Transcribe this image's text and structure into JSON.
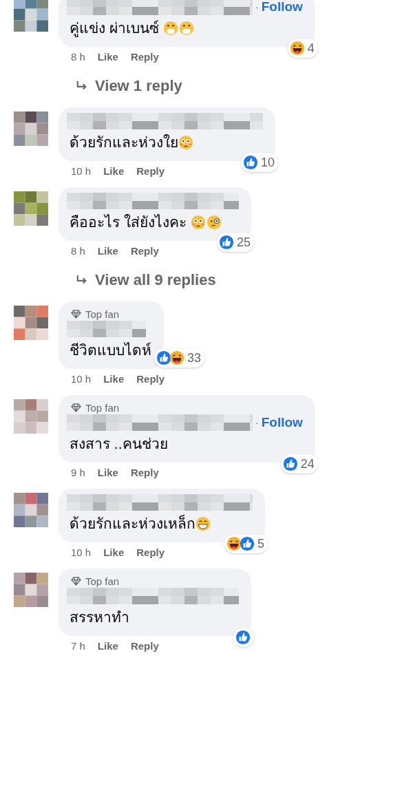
{
  "comments": [
    {
      "follow_separator": "·",
      "follow": "Follow",
      "text": "คู่แข่ง ผ่าเบนซ์ ",
      "reaction_count": "4",
      "time": "8 h",
      "like": "Like",
      "reply": "Reply",
      "view_replies": "View 1 reply"
    },
    {
      "text": "ด้วยรักและห่วงใย",
      "reaction_count": "10",
      "time": "10 h",
      "like": "Like",
      "reply": "Reply"
    },
    {
      "text": "คืออะไร ใส่ยังไงคะ ",
      "reaction_count": "25",
      "time": "8 h",
      "like": "Like",
      "reply": "Reply",
      "view_replies": "View all 9 replies"
    },
    {
      "badge": "Top fan",
      "text": "ชีวิตแบบไดห์",
      "reaction_count": "33",
      "time": "10 h",
      "like": "Like",
      "reply": "Reply"
    },
    {
      "badge": "Top fan",
      "follow_separator": "·",
      "follow": "Follow",
      "text": "สงสาร ..คนช่วย",
      "reaction_count": "24",
      "time": "9 h",
      "like": "Like",
      "reply": "Reply"
    },
    {
      "text": "ด้วยรักและห่วงเหล็ก",
      "reaction_count": "5",
      "time": "10 h",
      "like": "Like",
      "reply": "Reply"
    },
    {
      "badge": "Top fan",
      "text": "สรรหาทำ",
      "time": "7 h",
      "like": "Like",
      "reply": "Reply"
    }
  ]
}
